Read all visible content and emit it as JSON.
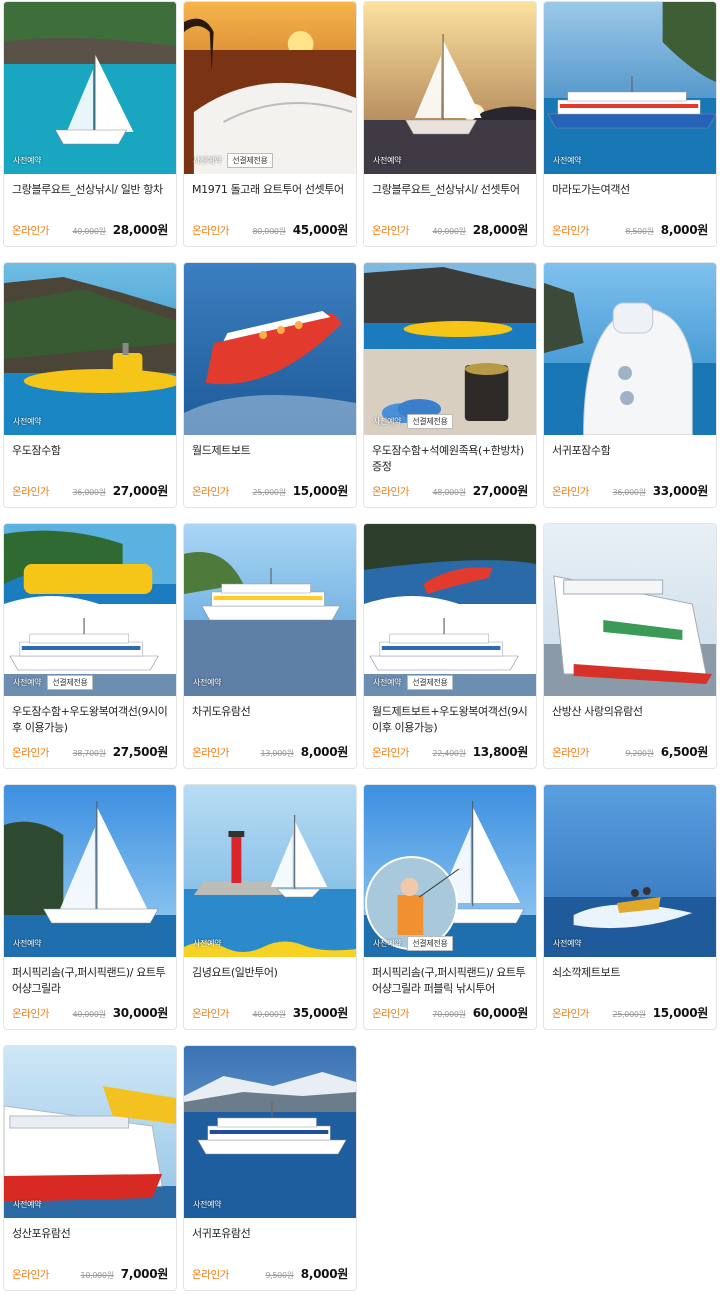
{
  "labels": {
    "online_price": "온라인가"
  },
  "scene_colors": {
    "sky": "#6fb5ea",
    "sea": "#1a7fc2",
    "sunset_sky": "#f08a2a",
    "sunset_sea": "#7a3a14",
    "cliff": "#3b3a33",
    "green": "#4c8a3a",
    "boat_white": "#f5f7fa",
    "sub_yellow": "#f5c518",
    "jet_red": "#e23b2e",
    "ferry_blue": "#1f4e9a"
  },
  "products": [
    {
      "title": "그랑블루요트_선상낚시/ 일반 항차",
      "original_price": "40,000원",
      "price": "28,000원",
      "badges": [
        "사전예약"
      ],
      "scene": "sailboat_tropical"
    },
    {
      "title": "M1971 돌고래 요트투어 선셋투어",
      "original_price": "80,000원",
      "price": "45,000원",
      "badges": [
        "사전예약",
        "선결제전용"
      ],
      "scene": "yacht_sunset"
    },
    {
      "title": "그랑블루요트_선상낚시/ 선셋투어",
      "original_price": "40,000원",
      "price": "28,000원",
      "badges": [
        "사전예약"
      ],
      "scene": "sailboat_sunset"
    },
    {
      "title": "마라도가는여객선",
      "original_price": "8,500원",
      "price": "8,000원",
      "badges": [
        "사전예약"
      ],
      "scene": "ferry_blue"
    },
    {
      "title": "우도잠수함",
      "original_price": "36,000원",
      "price": "27,000원",
      "badges": [
        "사전예약"
      ],
      "scene": "submarine_cliff"
    },
    {
      "title": "월드제트보트",
      "original_price": "25,000원",
      "price": "15,000원",
      "badges": [],
      "scene": "jetboat"
    },
    {
      "title": "우도잠수함+석예원족욕(+한방차) 증정",
      "original_price": "48,000원",
      "price": "27,000원",
      "badges": [
        "사전예약",
        "선결제전용"
      ],
      "scene": "submarine_tea"
    },
    {
      "title": "서귀포잠수함",
      "original_price": "36,000원",
      "price": "33,000원",
      "badges": [],
      "scene": "submarine_white"
    },
    {
      "title": "우도잠수함+우도왕복여객선(9시이후 이용가능)",
      "original_price": "38,700원",
      "price": "27,500원",
      "badges": [
        "사전예약",
        "선결제전용"
      ],
      "scene": "combo_sub_ferry"
    },
    {
      "title": "차귀도유람선",
      "original_price": "13,000원",
      "price": "8,000원",
      "badges": [
        "사전예약"
      ],
      "scene": "cruise_white"
    },
    {
      "title": "월드제트보트+우도왕복여객선(9시이후 이용가능)",
      "original_price": "22,400원",
      "price": "13,800원",
      "badges": [
        "사전예약",
        "선결제전용"
      ],
      "scene": "combo_jet_ferry"
    },
    {
      "title": "산방산 사랑의유람선",
      "original_price": "9,200원",
      "price": "6,500원",
      "badges": [],
      "scene": "cruise_big"
    },
    {
      "title": "퍼시픽리솜(구,퍼시픽랜드)/ 요트투어샹그릴라",
      "original_price": "40,000원",
      "price": "30,000원",
      "badges": [
        "사전예약"
      ],
      "scene": "catamaran"
    },
    {
      "title": "김녕요트(일반투어)",
      "original_price": "40,000원",
      "price": "35,000원",
      "badges": [
        "사전예약"
      ],
      "scene": "lighthouse_yacht"
    },
    {
      "title": "퍼시픽리솜(구,퍼시픽랜드)/ 요트투어샹그릴라 퍼블릭 낚시투어",
      "original_price": "70,000원",
      "price": "60,000원",
      "badges": [
        "사전예약",
        "선결제전용"
      ],
      "scene": "catamaran_fishing"
    },
    {
      "title": "쇠소깍제트보트",
      "original_price": "25,000원",
      "price": "15,000원",
      "badges": [
        "사전예약"
      ],
      "scene": "jetboat_sea"
    },
    {
      "title": "성산포유람선",
      "original_price": "10,000원",
      "price": "7,000원",
      "badges": [
        "사전예약"
      ],
      "scene": "ferry_red"
    },
    {
      "title": "서귀포유람선",
      "original_price": "9,500원",
      "price": "8,000원",
      "badges": [
        "사전예약"
      ],
      "scene": "cruise_mountain"
    }
  ]
}
